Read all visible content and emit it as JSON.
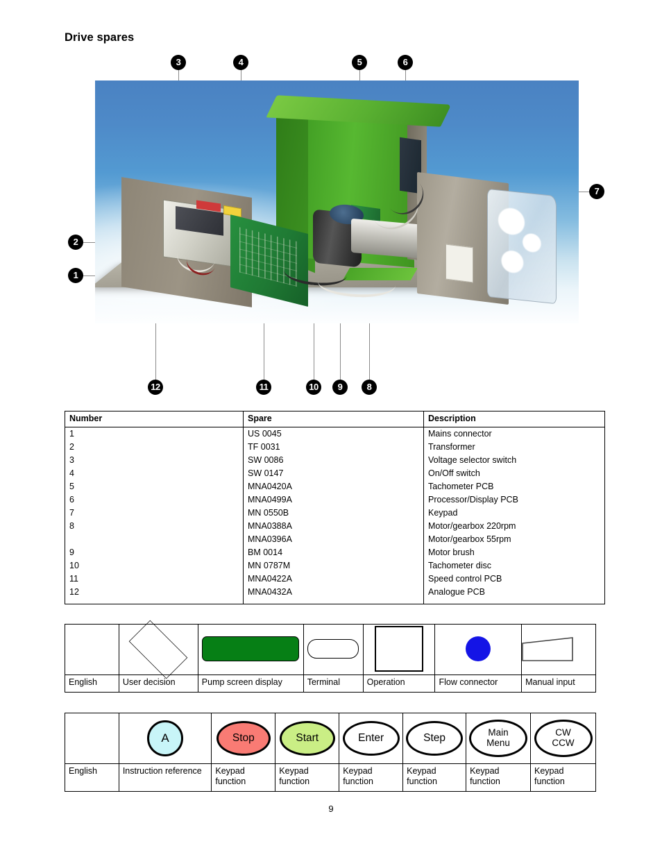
{
  "document": {
    "heading": "Drive spares",
    "page_number": "9"
  },
  "figure": {
    "alt": "Cut-away photograph of peristaltic pump drive with numbered callouts",
    "callouts": [
      {
        "id": "1",
        "label": "1"
      },
      {
        "id": "2",
        "label": "2"
      },
      {
        "id": "3",
        "label": "3"
      },
      {
        "id": "4",
        "label": "4"
      },
      {
        "id": "5",
        "label": "5"
      },
      {
        "id": "6",
        "label": "6"
      },
      {
        "id": "7",
        "label": "7"
      },
      {
        "id": "8",
        "label": "8"
      },
      {
        "id": "9",
        "label": "9"
      },
      {
        "id": "10",
        "label": "10"
      },
      {
        "id": "11",
        "label": "11"
      },
      {
        "id": "12",
        "label": "12"
      }
    ]
  },
  "spares_table": {
    "headers": [
      "Number",
      "Spare",
      "Description"
    ],
    "rows": [
      {
        "number": "1",
        "spare": "US 0045",
        "description": "Mains connector"
      },
      {
        "number": "2",
        "spare": "TF 0031",
        "description": "Transformer"
      },
      {
        "number": "3",
        "spare": "SW 0086",
        "description": "Voltage selector switch"
      },
      {
        "number": "4",
        "spare": "SW 0147",
        "description": "On/Off switch"
      },
      {
        "number": "5",
        "spare": "MNA0420A",
        "description": "Tachometer PCB"
      },
      {
        "number": "6",
        "spare": "MNA0499A",
        "description": "Processor/Display PCB"
      },
      {
        "number": "7",
        "spare": "MN 0550B",
        "description": "Keypad"
      },
      {
        "number": "8",
        "spare": "MNA0388A",
        "description": "Motor/gearbox 220rpm"
      },
      {
        "number": "",
        "spare": "MNA0396A",
        "description": "Motor/gearbox 55rpm"
      },
      {
        "number": "9",
        "spare": "BM 0014",
        "description": "Motor brush"
      },
      {
        "number": "10",
        "spare": "MN 0787M",
        "description": "Tachometer disc"
      },
      {
        "number": "11",
        "spare": "MNA0422A",
        "description": "Speed control PCB"
      },
      {
        "number": "12",
        "spare": "MNA0432A",
        "description": "Analogue PCB"
      }
    ]
  },
  "legend_shapes": {
    "cells": [
      {
        "symbol": "none",
        "label": "English"
      },
      {
        "symbol": "diamond",
        "label": "User decision"
      },
      {
        "symbol": "screen",
        "label": "Pump screen display"
      },
      {
        "symbol": "terminal",
        "label": "Terminal"
      },
      {
        "symbol": "operation",
        "label": "Operation"
      },
      {
        "symbol": "flow",
        "label": "Flow connector"
      },
      {
        "symbol": "manual-input",
        "label": "Manual input"
      }
    ],
    "colors": {
      "pump_screen_display": "#067f15",
      "flow_connector": "#1414e6"
    }
  },
  "legend_keypad": {
    "cells": [
      {
        "key": "",
        "label": "English"
      },
      {
        "key": "A",
        "label": "Instruction reference"
      },
      {
        "key": "Stop",
        "label": "Keypad\nfunction"
      },
      {
        "key": "Start",
        "label": "Keypad\nfunction"
      },
      {
        "key": "Enter",
        "label": "Keypad\nfunction"
      },
      {
        "key": "Step",
        "label": "Keypad\nfunction"
      },
      {
        "key": "Main Menu",
        "label": "Keypad\nfunction"
      },
      {
        "key": "CW CCW",
        "label": "Keypad\nfunction"
      }
    ],
    "key_line1": {
      "main_menu": "Main",
      "cw_ccw": "CW"
    },
    "key_line2": {
      "main_menu": "Menu",
      "cw_ccw": "CCW"
    },
    "colors": {
      "instruction_reference": "#c8f5f8",
      "stop": "#f97b74",
      "start": "#caee85"
    },
    "label_line1": "Keypad",
    "label_line2": "function"
  }
}
